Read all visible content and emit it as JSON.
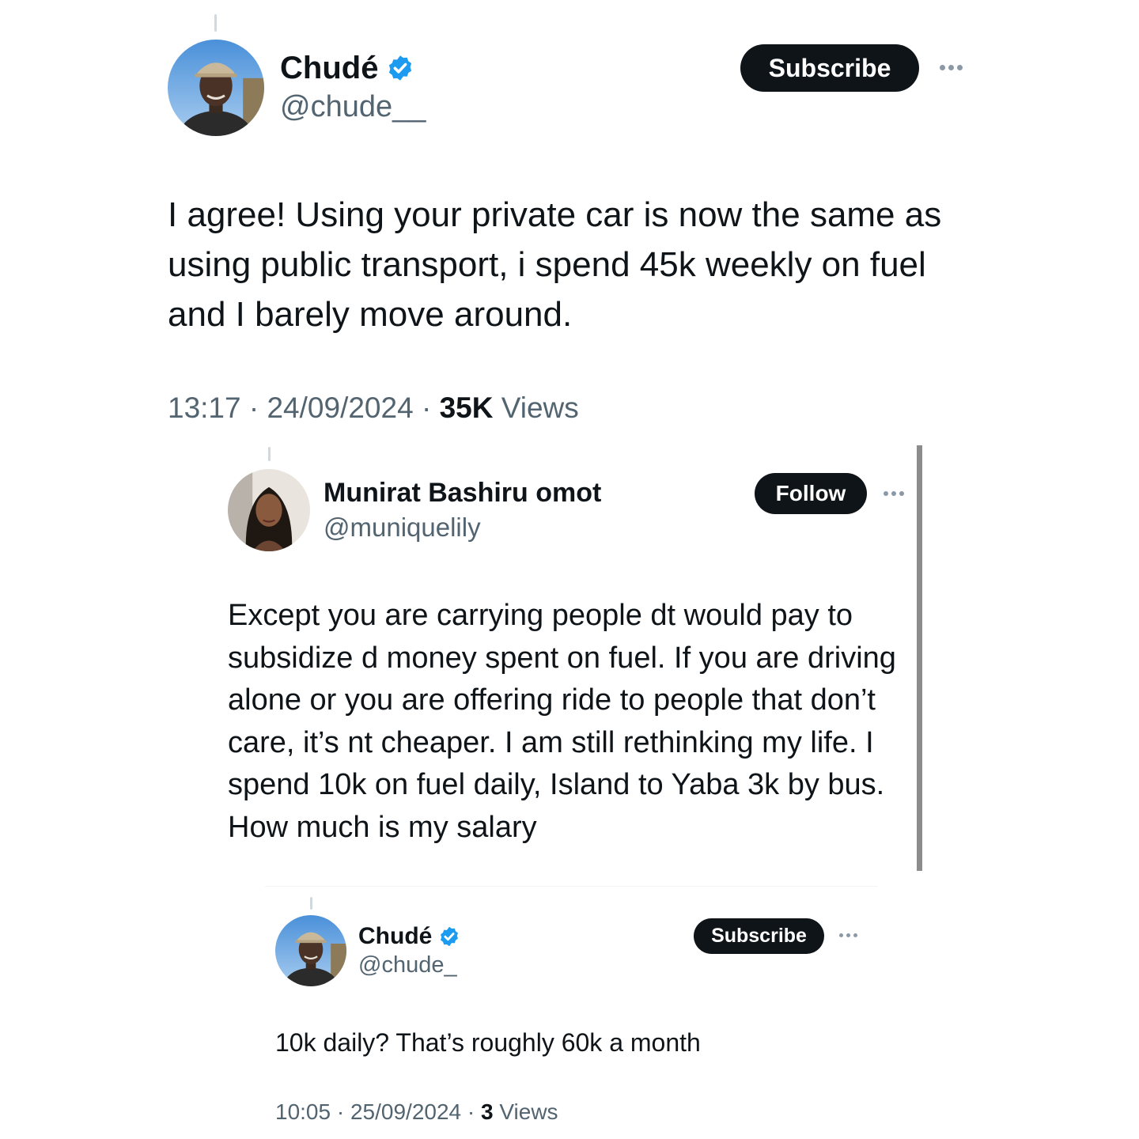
{
  "tweet1": {
    "name": "Chudé",
    "handle": "@chude__",
    "button": "Subscribe",
    "text": "I agree! Using your private car is now the same as using public transport, i spend 45k weekly on fuel and I barely move around.",
    "time": "13:17",
    "date": "24/09/2024",
    "views_count": "35K",
    "views_label": "Views",
    "separator": "·"
  },
  "tweet2": {
    "name": "Munirat Bashiru omot",
    "handle": "@muniquelily",
    "button": "Follow",
    "text": "Except you are carrying people dt would pay to subsidize d money spent on fuel. If you are driving alone or you are offering ride to people that don’t care, it’s nt cheaper. I am still rethinking my life. I spend 10k on fuel daily, Island to Yaba 3k by bus. How much is my salary"
  },
  "tweet3": {
    "name": "Chudé",
    "handle": "@chude_",
    "button": "Subscribe",
    "text": "10k daily? That’s roughly 60k a month",
    "time": "10:05",
    "date": "25/09/2024",
    "views_count": "3",
    "views_label": "Views",
    "separator": "·"
  },
  "icons": {
    "verified": "verified-badge-icon",
    "more": "more-options-icon"
  },
  "colors": {
    "verified_blue": "#1d9bf0",
    "button_black": "#0f1419",
    "secondary_text": "#536471"
  }
}
